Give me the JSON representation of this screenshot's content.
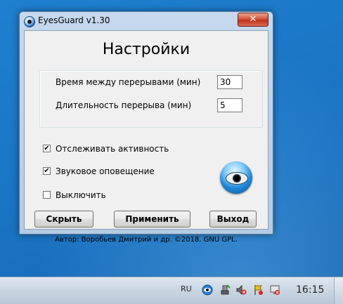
{
  "window": {
    "title": "EyesGuard v1.30",
    "close_label": "✕"
  },
  "heading": "Настройки",
  "fields": [
    {
      "label": "Время между перерывами (мин)",
      "value": "30"
    },
    {
      "label": "Длительность перерыва (мин)",
      "value": "5"
    }
  ],
  "checkboxes": [
    {
      "label": "Отслеживать активность",
      "checked": true,
      "mark": "✔"
    },
    {
      "label": "Звуковое оповещение",
      "checked": true,
      "mark": "✔"
    },
    {
      "label": "Выключить",
      "checked": false,
      "mark": ""
    }
  ],
  "buttons": {
    "hide": "Скрыть",
    "apply": "Применить",
    "exit": "Выход"
  },
  "footer": "Автор: Воробьев Дмитрий и др.   ©2018. GNU GPL.",
  "taskbar": {
    "language": "RU",
    "clock": "16:15",
    "tray_icons": [
      "eyesguard-icon",
      "usb-safely-remove-icon",
      "volume-muted-icon",
      "action-center-icon",
      "network-disconnected-icon"
    ]
  }
}
